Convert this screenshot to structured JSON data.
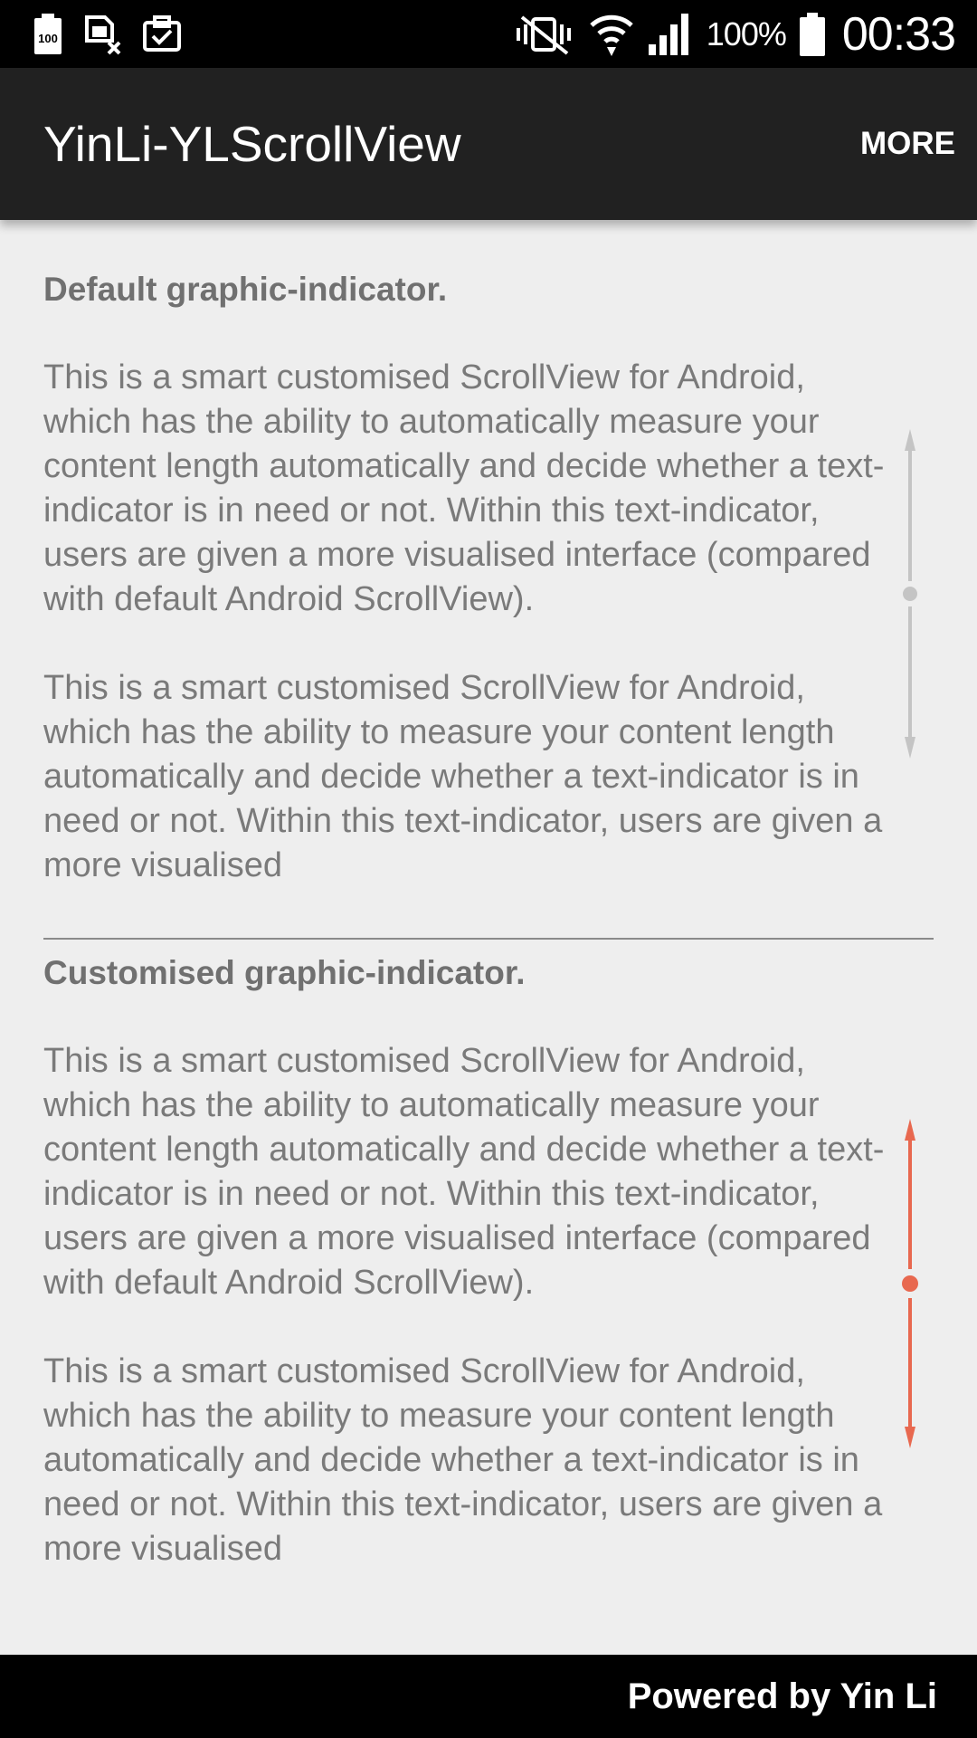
{
  "status_bar": {
    "icons_left": [
      "battery-100-icon",
      "sim-card-off-icon",
      "clipboard-check-icon"
    ],
    "icons_right": [
      "vibrate-mute-icon",
      "wifi-icon",
      "cellular-signal-icon",
      "battery-icon"
    ],
    "battery_percent": "100%",
    "time": "00:33"
  },
  "app_bar": {
    "title": "YinLi-YLScrollView",
    "more_label": "MORE"
  },
  "sections": [
    {
      "heading": "Default graphic-indicator.",
      "paragraphs": [
        "This is a smart customised ScrollView for Android, which has the ability to automatically measure your content length automatically and decide whether a text-indicator is in need or not. Within this text-indicator, users are given a more visualised interface (compared with default Android ScrollView).",
        "This is a smart customised ScrollView for Android, which has the ability to measure your content length automatically and decide whether a text-indicator is in need or not. Within this text-indicator, users are given a more visualised"
      ],
      "indicator_color": "#bdbdbd"
    },
    {
      "heading": "Customised graphic-indicator.",
      "paragraphs": [
        "This is a smart customised ScrollView for Android, which has the ability to automatically measure your content length automatically and decide whether a text-indicator is in need or not. Within this text-indicator, users are given a more visualised interface (compared with default Android ScrollView).",
        "This is a smart customised ScrollView for Android, which has the ability to measure your content length automatically and decide whether a text-indicator is in need or not. Within this text-indicator, users are given a more visualised"
      ],
      "indicator_color": "#e8684f"
    }
  ],
  "footer": {
    "text": "Powered by Yin Li"
  },
  "colors": {
    "status_bar": "#000000",
    "app_bar": "#212121",
    "background": "#eeeeee",
    "text": "#7a7a7a",
    "footer": "#000000"
  }
}
